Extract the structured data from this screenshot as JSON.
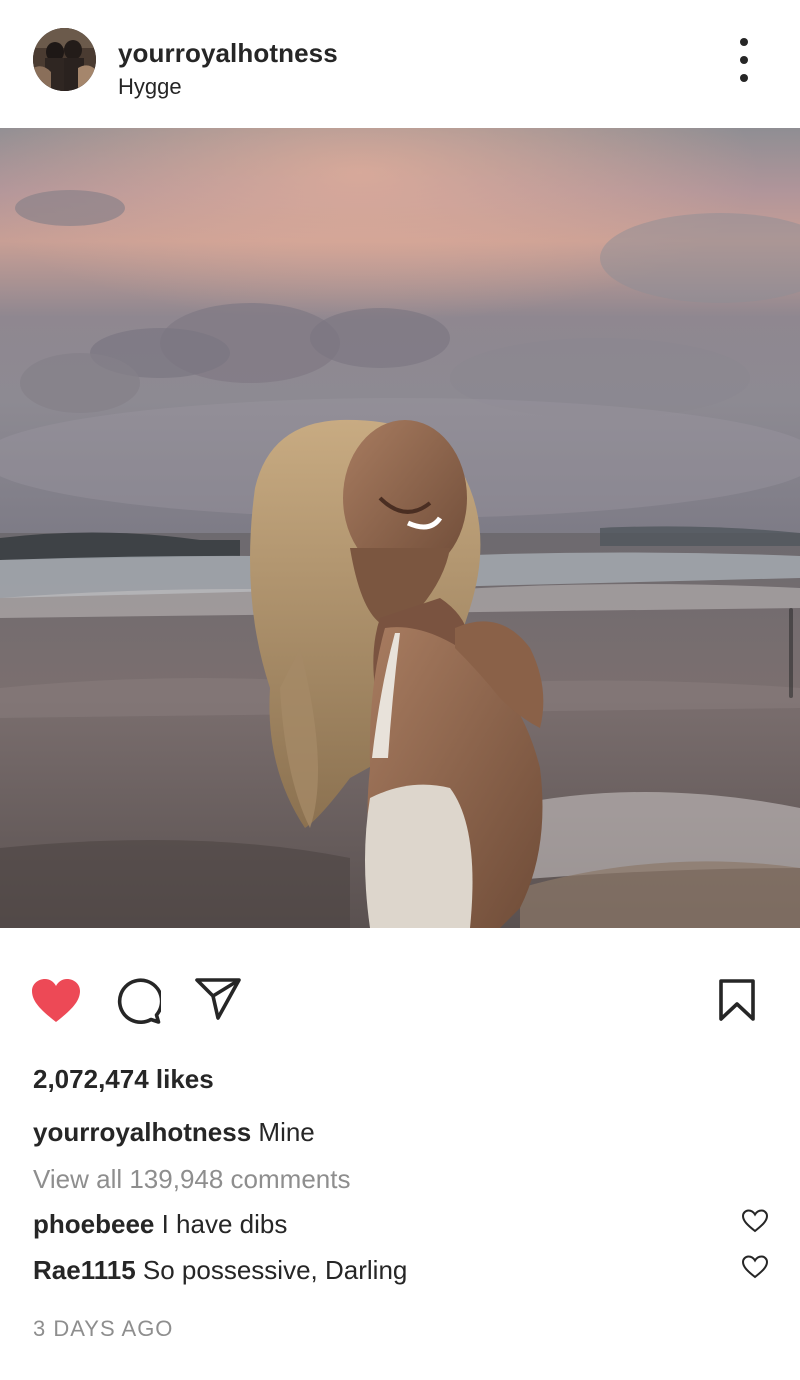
{
  "post": {
    "username": "yourroyalhotness",
    "location": "Hygge",
    "likes_text": "2,072,474 likes",
    "caption": {
      "username": "yourroyalhotness",
      "text": "Mine"
    },
    "view_all_comments": "View all 139,948 comments",
    "comments": [
      {
        "username": "phoebeee",
        "text": "I have dibs"
      },
      {
        "username": "Rae1115",
        "text": "So possessive, Darling"
      }
    ],
    "timestamp": "3 DAYS AGO",
    "liked": true
  },
  "icons": {
    "more": "more-options-icon",
    "like": "heart-filled-icon",
    "comment": "comment-bubble-icon",
    "share": "paper-plane-icon",
    "save": "bookmark-icon",
    "comment_like": "heart-outline-icon"
  },
  "colors": {
    "like_red": "#ED4956",
    "text": "#262626",
    "muted": "#8E8E8E"
  }
}
